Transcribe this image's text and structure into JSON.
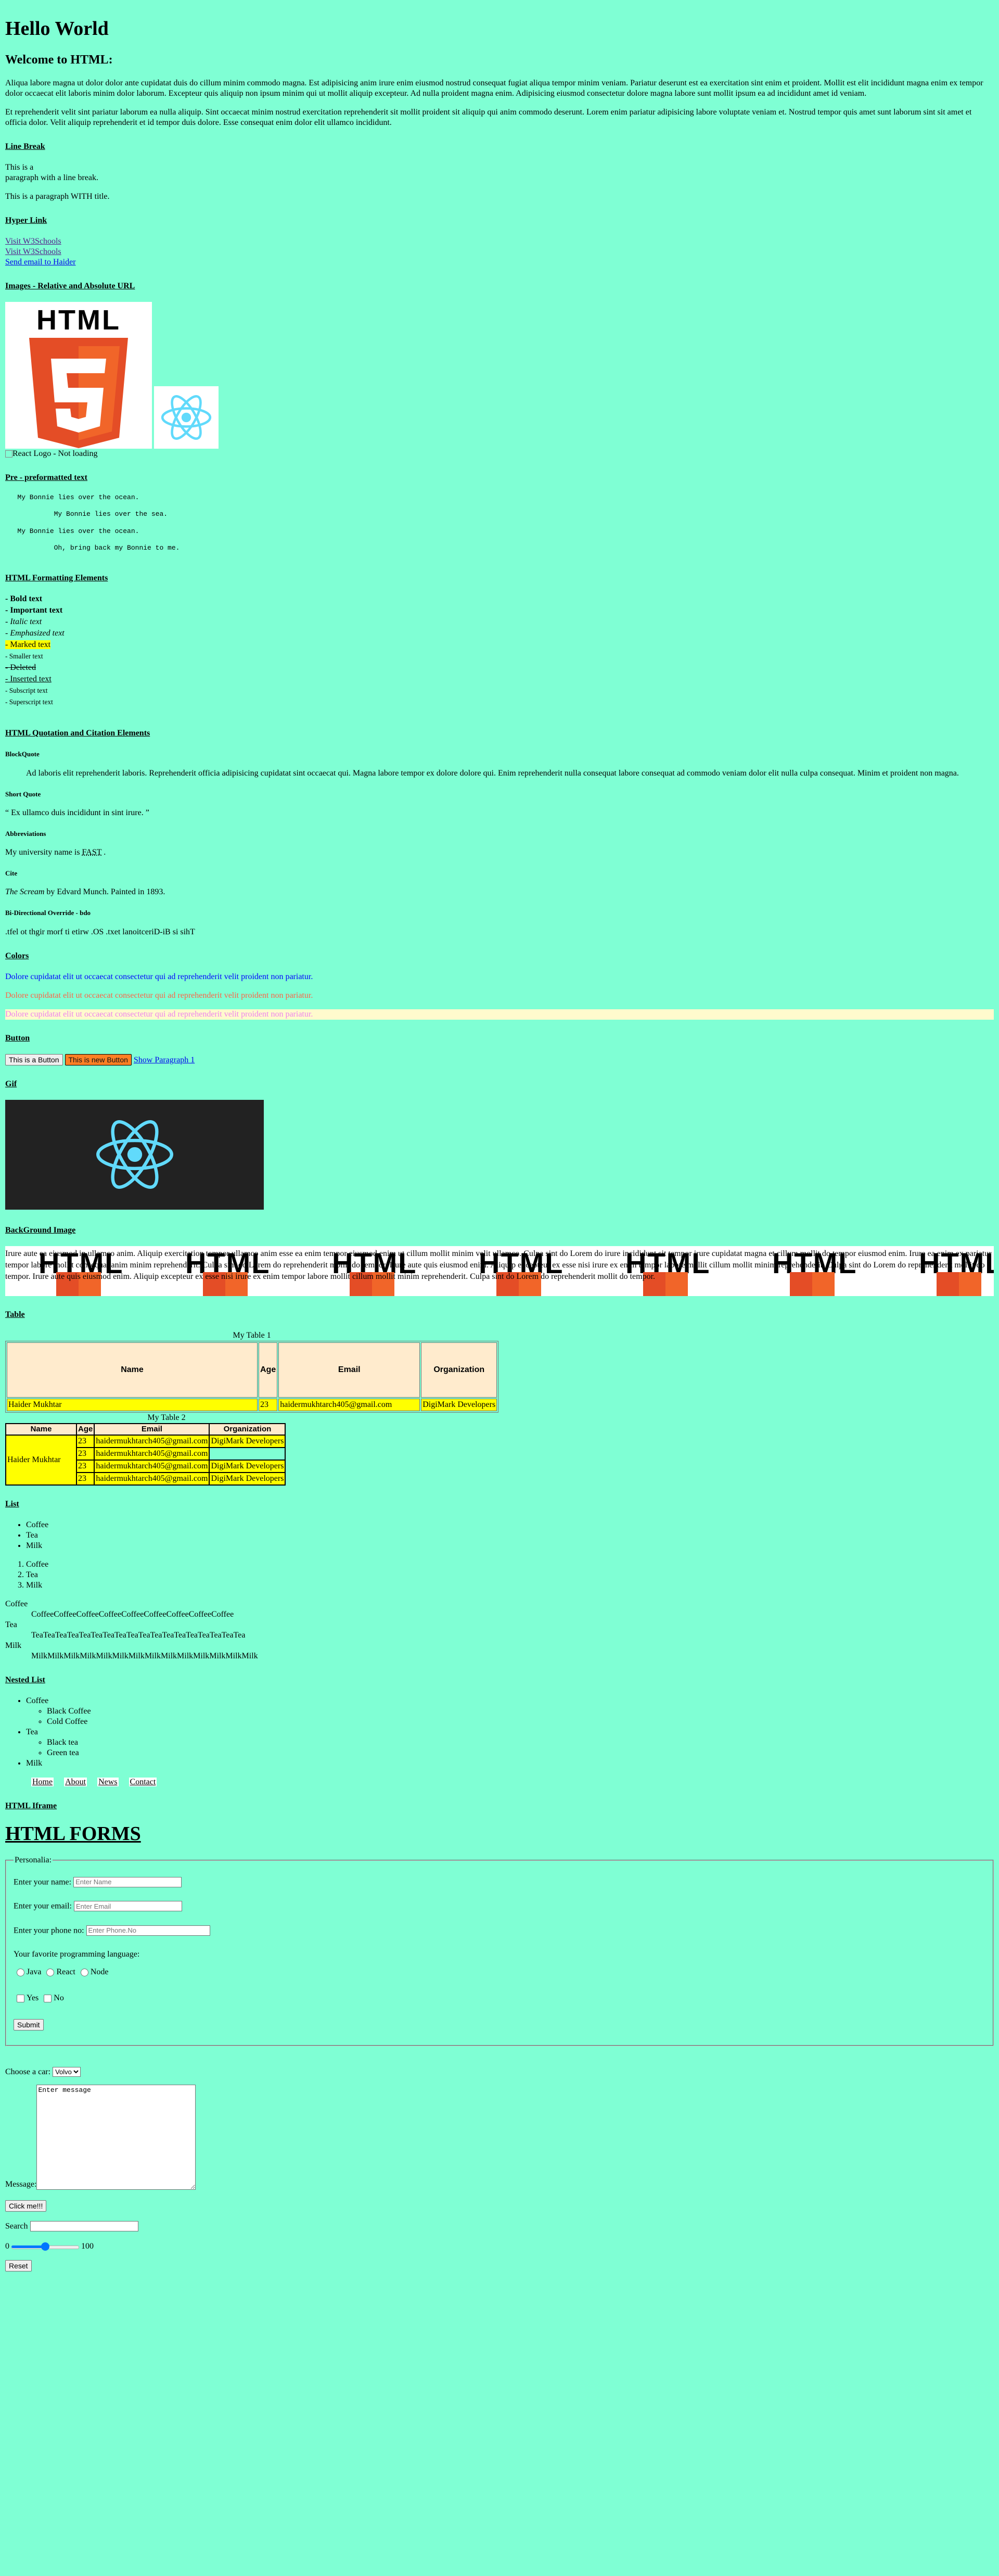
{
  "heading": "Hello World",
  "welcome": "Welcome to HTML:",
  "paragraphs": [
    "Aliqua labore magna ut dolor dolor ante cupidatat duis do cillum minim commodo magna. Est adipisicing anim irure enim eiusmod nostrud consequat fugiat aliqua tempor minim veniam. Pariatur deserunt est ea exercitation sint enim et proident. Mollit est elit incididunt magna enim ex tempor dolor occaecat elit laboris minim dolor laborum. Excepteur quis aliquip non ipsum minim qui ut mollit aliquip excepteur. Ad nulla proident magna enim. Adipisicing eiusmod consectetur dolore magna labore sunt mollit ipsum ea ad incididunt amet id veniam.",
    "Et reprehenderit velit sint pariatur laborum ea nulla aliquip. Sint occaecat minim nostrud exercitation reprehenderit sit mollit proident sit aliquip qui anim commodo deserunt. Lorem enim pariatur adipisicing labore voluptate veniam et. Nostrud tempor quis amet sunt laborum sint sit amet et officia dolor. Velit aliquip reprehenderit et id tempor duis dolore. Esse consequat enim dolor elit ullamco incididunt."
  ],
  "line_break": {
    "title": "Line Break",
    "line1": "This is a",
    "line2": "paragraph with a line break.",
    "titled": "This is a paragraph WITH title."
  },
  "hyperlink": {
    "title": "Hyper Link",
    "link1": "Visit W3Schools",
    "link2": "Visit W3Schools",
    "link3": "Send email to Haider"
  },
  "images": {
    "title": "Images - Relative and Absolute URL",
    "html5_text": "HTML",
    "broken_alt": "React Logo - Not loading"
  },
  "pre": {
    "title": "Pre - preformatted text",
    "text": "   My Bonnie lies over the ocean.\n\n            My Bonnie lies over the sea.\n\n   My Bonnie lies over the ocean.\n\n            Oh, bring back my Bonnie to me."
  },
  "formatting": {
    "title": "HTML Formatting Elements",
    "items": [
      "- Bold text",
      "- Important text",
      "- Italic text",
      "- Emphasized text",
      "- Marked text",
      "- Smaller text",
      "- Deleted",
      "- Inserted text",
      "- Subscript text",
      "- Superscript text"
    ]
  },
  "quotation": {
    "title": "HTML Quotation and Citation Elements",
    "blockquote_title": "BlockQuote",
    "blockquote": "Ad laboris elit reprehenderit laboris. Reprehenderit officia adipisicing cupidatat sint occaecat qui. Magna labore tempor ex dolore dolore qui. Enim reprehenderit nulla consequat labore consequat ad commodo veniam dolor elit nulla culpa consequat. Minim et proident non magna.",
    "short_title": "Short Quote",
    "short": "“ Ex ullamco duis incididunt in sint irure. ”",
    "abbr_title": "Abbreviations",
    "abbr_prefix": "My university name is ",
    "abbr": "FAST",
    "abbr_suffix": " .",
    "cite_title": "Cite",
    "cite_work": "The Scream",
    "cite_rest": " by Edvard Munch. Painted in 1893.",
    "bdo_title": "Bi-Directional Override - bdo",
    "bdo": ".tfel ot thgir morf ti etirw .OS .txet lanoitceriD-iB si sihT"
  },
  "colors": {
    "title": "Colors",
    "line": "Dolore cupidatat elit ut occaecat consectetur qui ad reprehenderit velit proident non pariatur.",
    "accent_blue": "#0000ff",
    "accent_tomato": "#ff6347",
    "accent_violet": "#ee82ee"
  },
  "buttons": {
    "title": "Button",
    "btn1": "This is a Button",
    "btn2": "This is new Button",
    "link": "Show Paragraph 1"
  },
  "gif": {
    "title": "Gif"
  },
  "bgimage": {
    "title": "BackGround Image",
    "text": "Irure aute ea eiusmod in ullamco anim. Aliquip exercitation tempor ullamco anim esse ea enim tempor eiusmod enim ut cillum mollit minim velit ullamco. Culpa sint do Lorem do irure incididunt sit tempor irure cupidatat magna et cillum mollit do tempor eiusmod enim. Irure ea enim ex pariatur tempor labore mollit consequat anim minim reprehenderit. Culpa sint do Lorem do reprehenderit mollit do tempor. Irure aute quis eiusmod enim. Aliquip excepteur ex esse nisi irure ex enim tempor labore mollit cillum mollit minim reprehenderit. Culpa sint do Lorem do reprehenderit mollit do tempor. Irure aute quis eiusmod enim. Aliquip excepteur ex esse nisi irure ex enim tempor labore mollit cillum mollit minim reprehenderit. Culpa sint do Lorem do reprehenderit mollit do tempor.",
    "tile_text": "HTML"
  },
  "tables": {
    "title": "Table",
    "t1_caption": "My Table 1",
    "t2_caption": "My Table 2",
    "headers": [
      "Name",
      "Age",
      "Email",
      "Organization"
    ],
    "t1_row": [
      "Haider Mukhtar",
      "23",
      "haidermukhtarch405@gmail.com",
      "DigiMark Developers"
    ],
    "t2_name": "Haider Mukhtar",
    "t2_rows": [
      [
        "23",
        "haidermukhtarch405@gmail.com",
        "DigiMark Developers"
      ],
      [
        "23",
        "haidermukhtarch405@gmail.com",
        ""
      ],
      [
        "23",
        "haidermukhtarch405@gmail.com",
        "DigiMark Developers"
      ],
      [
        "23",
        "haidermukhtarch405@gmail.com",
        "DigiMark Developers"
      ]
    ]
  },
  "lists": {
    "title": "List",
    "ul": [
      "Coffee",
      "Tea",
      "Milk"
    ],
    "ol": [
      "Coffee",
      "Tea",
      "Milk"
    ],
    "dl": [
      {
        "term": "Coffee",
        "desc": "CoffeeCoffeeCoffeeCoffeeCoffeeCoffeeCoffeeCoffeeCoffee"
      },
      {
        "term": "Tea",
        "desc": "TeaTeaTeaTeaTeaTeaTeaTeaTeaTeaTeaTeaTeaTeaTeaTeaTeaTea"
      },
      {
        "term": "Milk",
        "desc": "MilkMilkMilkMilkMilkMilkMilkMilkMilkMilkMilkMilkMilkMilk"
      }
    ]
  },
  "nested": {
    "title": "Nested List",
    "coffee": "Coffee",
    "coffee_sub": [
      "Black Coffee",
      "Cold Coffee"
    ],
    "tea": "Tea",
    "tea_sub": [
      "Black tea",
      "Green tea"
    ],
    "milk": "Milk",
    "nav": [
      "Home",
      "About",
      "News",
      "Contact"
    ]
  },
  "iframe": {
    "title": "HTML Iframe"
  },
  "forms": {
    "title": "HTML FORMS",
    "legend": "Personalia:",
    "name_label": "Enter your name:",
    "name_ph": "Enter Name",
    "email_label": "Enter your email:",
    "email_ph": "Enter Email",
    "phone_label": "Enter your phone no:",
    "phone_ph": "Enter Phone.No",
    "fav_label": "Your favorite programming language:",
    "radios": [
      "Java",
      "React",
      "Node"
    ],
    "checks": [
      "Yes",
      "No"
    ],
    "submit": "Submit",
    "car_label": "Choose a car:",
    "car_value": "Volvo",
    "textarea_value": "Enter message",
    "message_label": "Message:",
    "click_btn": "Click me!!!",
    "search_label": "Search",
    "range_min": "0",
    "range_max": "100",
    "range_value": 50,
    "reset": "Reset"
  }
}
